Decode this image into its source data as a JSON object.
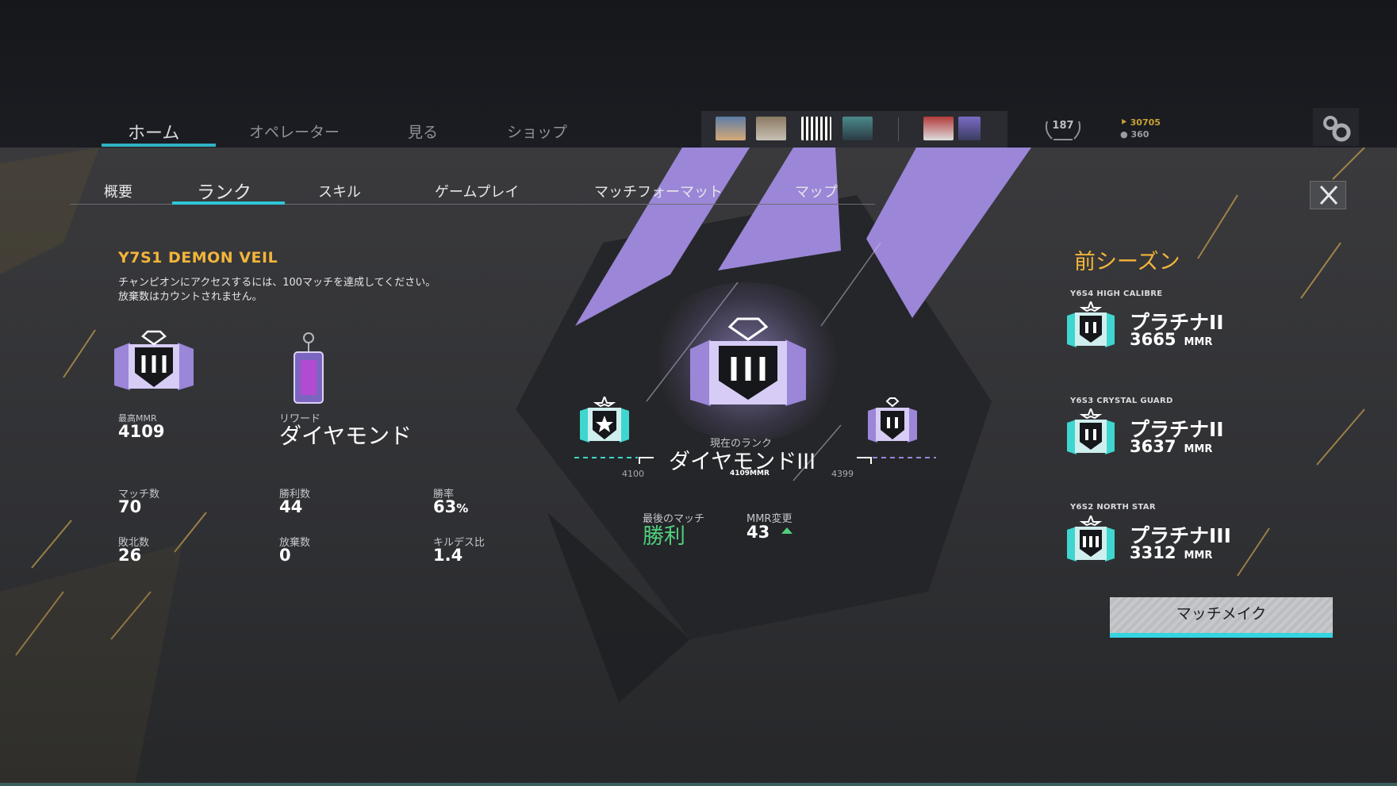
{
  "top_nav": {
    "tabs": [
      {
        "label": "ホーム",
        "active": true
      },
      {
        "label": "オペレーター"
      },
      {
        "label": "見る"
      },
      {
        "label": "ショップ"
      }
    ],
    "level": "187",
    "currency_primary": "30705",
    "currency_secondary": "360"
  },
  "sub_tabs": [
    "概要",
    "ランク",
    "スキル",
    "ゲームプレイ",
    "マッチフォーマット",
    "マップ"
  ],
  "active_sub_tab": "ランク",
  "season": {
    "name": "Y7S1 DEMON VEIL",
    "note_line1": "チャンピオンにアクセスするには、100マッチを達成してください。",
    "note_line2": "放棄数はカウントされません。"
  },
  "left_stats": {
    "best_mmr_label": "最高MMR",
    "best_mmr": "4109",
    "reward_label": "リワード",
    "reward_value": "ダイヤモンド",
    "matches_label": "マッチ数",
    "matches": "70",
    "wins_label": "勝利数",
    "wins": "44",
    "win_rate_label": "勝率",
    "win_rate": "63",
    "win_rate_unit": "%",
    "losses_label": "敗北数",
    "losses": "26",
    "abandons_label": "放棄数",
    "abandons": "0",
    "kd_label": "キルデス比",
    "kd": "1.4"
  },
  "current": {
    "label": "現在のランク",
    "rank": "ダイヤモンドIII",
    "mmr": "4109MMR",
    "range_low": "4100",
    "range_high": "4399",
    "last_match_label": "最後のマッチ",
    "last_match_result": "勝利",
    "mmr_change_label": "MMR変更",
    "mmr_change": "43"
  },
  "previous": {
    "title": "前シーズン",
    "seasons": [
      {
        "season": "Y6S4 HIGH CALIBRE",
        "rank": "プラチナII",
        "mmr": "3665",
        "unit": "MMR"
      },
      {
        "season": "Y6S3 CRYSTAL GUARD",
        "rank": "プラチナII",
        "mmr": "3637",
        "unit": "MMR"
      },
      {
        "season": "Y6S2 NORTH STAR",
        "rank": "プラチナIII",
        "mmr": "3312",
        "unit": "MMR"
      }
    ]
  },
  "matchmake_button": "マッチメイク",
  "colors": {
    "accent_cyan": "#2fc6d6",
    "gold": "#f2b53a",
    "purple": "#9b86d8",
    "win_green": "#4fcf7c"
  }
}
